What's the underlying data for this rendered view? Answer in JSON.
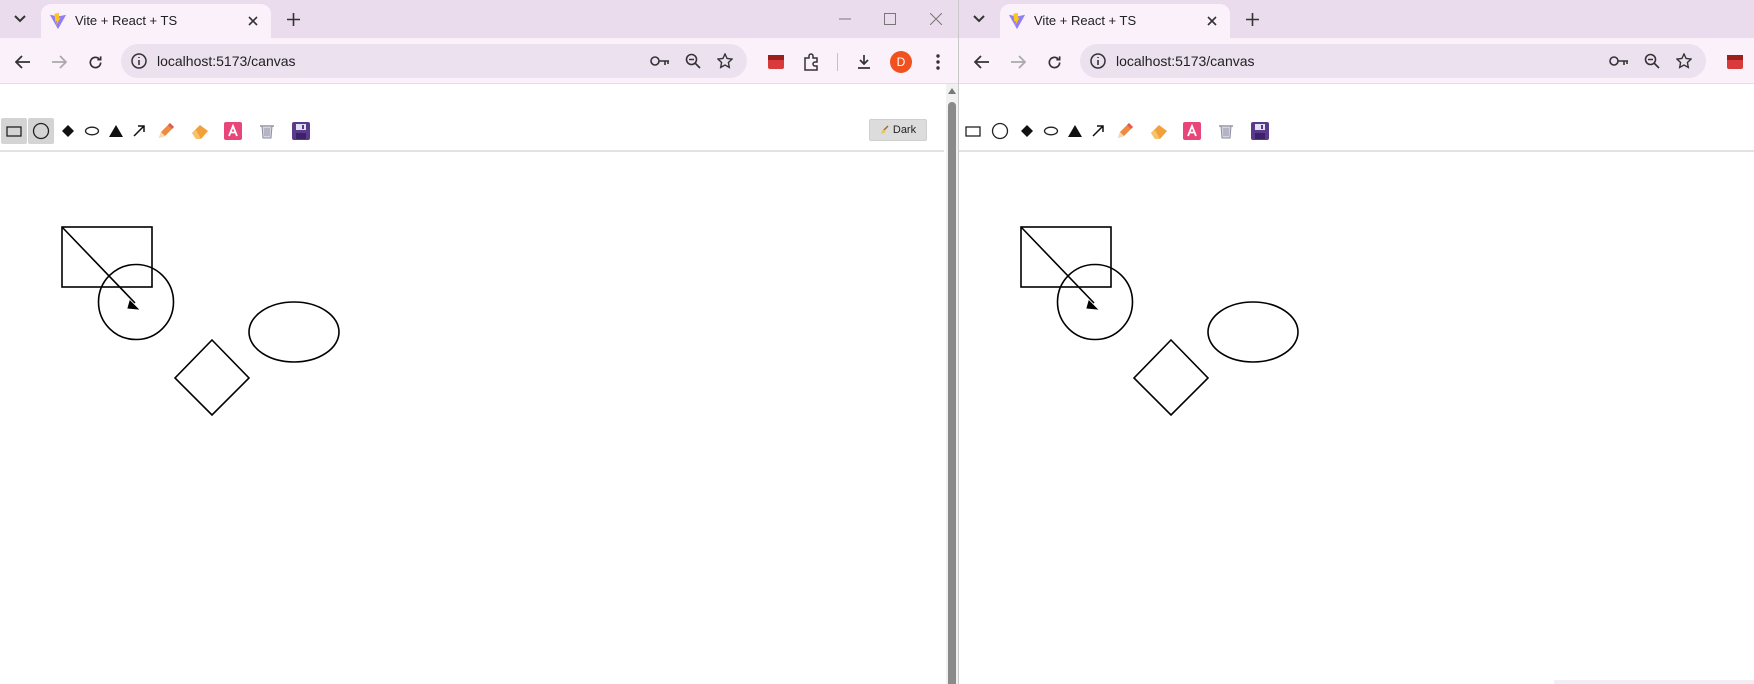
{
  "left_window": {
    "tab": {
      "title": "Vite + React + TS",
      "favicon": "vite-logo-icon"
    },
    "address_bar": {
      "url": "localhost:5173/canvas"
    },
    "profile_initial": "D",
    "theme_button": {
      "icon": "broom-icon",
      "label": "Dark"
    },
    "active_tool": "rectangle"
  },
  "right_window": {
    "tab": {
      "title": "Vite + React + TS",
      "favicon": "vite-logo-icon"
    },
    "address_bar": {
      "url": "localhost:5173/canvas"
    }
  },
  "tools": [
    {
      "id": "rectangle",
      "icon": "rectangle-tool-icon"
    },
    {
      "id": "circle",
      "icon": "circle-tool-icon"
    },
    {
      "id": "diamond",
      "icon": "diamond-tool-icon"
    },
    {
      "id": "ellipse",
      "icon": "ellipse-tool-icon"
    },
    {
      "id": "triangle",
      "icon": "triangle-tool-icon"
    },
    {
      "id": "arrow",
      "icon": "arrow-tool-icon"
    },
    {
      "id": "pencil",
      "icon": "pencil-icon"
    },
    {
      "id": "eraser",
      "icon": "eraser-icon"
    },
    {
      "id": "text",
      "icon": "text-a-icon"
    },
    {
      "id": "clear",
      "icon": "trash-icon"
    },
    {
      "id": "save",
      "icon": "floppy-disk-icon"
    }
  ],
  "colors": {
    "tabstrip": "#eadcec",
    "toolbar": "#fbf1fb",
    "omnibox": "#ece2ef",
    "avatar": "#f0511f",
    "pencil": "#e86a2e",
    "text_tool": "#e8457a",
    "save": "#5b3a8c"
  },
  "canvas_shapes": [
    "rectangle",
    "arrow",
    "circle",
    "ellipse",
    "diamond"
  ]
}
